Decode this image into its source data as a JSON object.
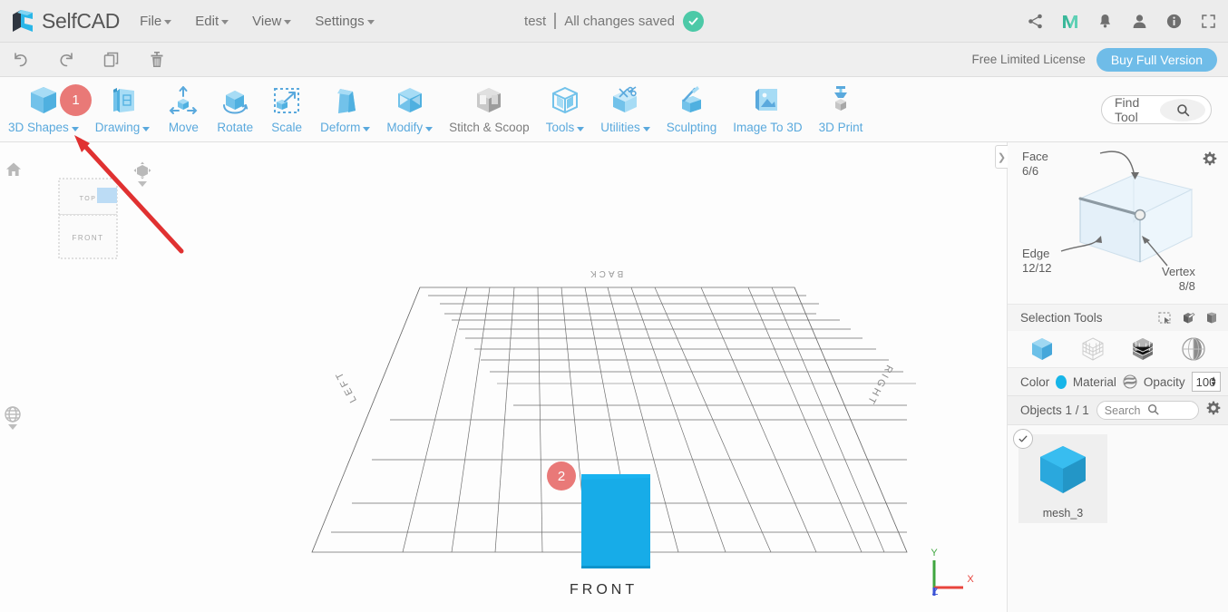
{
  "app": {
    "brand": "SelfCAD",
    "logo_icon": "selfcad-logo-icon"
  },
  "menubar": {
    "items": [
      {
        "label": "File",
        "has_caret": true
      },
      {
        "label": "Edit",
        "has_caret": true
      },
      {
        "label": "View",
        "has_caret": true
      },
      {
        "label": "Settings",
        "has_caret": true
      }
    ],
    "document_name": "test",
    "save_status": "All changes saved",
    "saved_icon": "check-circle-icon",
    "right_icons": [
      {
        "name": "share-icon"
      },
      {
        "name": "medium-logo-icon"
      },
      {
        "name": "bell-icon"
      },
      {
        "name": "user-icon"
      },
      {
        "name": "info-icon"
      },
      {
        "name": "fullscreen-icon"
      }
    ]
  },
  "editbar": {
    "buttons": [
      {
        "name": "undo-button",
        "icon": "undo-icon"
      },
      {
        "name": "redo-button",
        "icon": "redo-icon"
      },
      {
        "name": "duplicate-button",
        "icon": "copy-icon"
      },
      {
        "name": "delete-button",
        "icon": "trash-icon"
      }
    ],
    "license_text": "Free Limited License",
    "buy_label": "Buy Full Version"
  },
  "ribbon": {
    "tools": [
      {
        "label": "3D Shapes",
        "icon": "cube-icon",
        "caret": true,
        "disabled": false,
        "badge": "1"
      },
      {
        "label": "Drawing",
        "icon": "drawing-icon",
        "caret": true,
        "disabled": false
      },
      {
        "label": "Move",
        "icon": "move-icon",
        "caret": false,
        "disabled": false
      },
      {
        "label": "Rotate",
        "icon": "rotate-icon",
        "caret": false,
        "disabled": false
      },
      {
        "label": "Scale",
        "icon": "scale-icon",
        "caret": false,
        "disabled": false
      },
      {
        "label": "Deform",
        "icon": "deform-icon",
        "caret": true,
        "disabled": false
      },
      {
        "label": "Modify",
        "icon": "modify-icon",
        "caret": true,
        "disabled": false
      },
      {
        "label": "Stitch & Scoop",
        "icon": "stitch-scoop-icon",
        "caret": false,
        "disabled": true
      },
      {
        "label": "Tools",
        "icon": "tools-icon",
        "caret": true,
        "disabled": false
      },
      {
        "label": "Utilities",
        "icon": "utilities-icon",
        "caret": true,
        "disabled": false
      },
      {
        "label": "Sculpting",
        "icon": "sculpting-icon",
        "caret": false,
        "disabled": false
      },
      {
        "label": "Image To 3D",
        "icon": "image-to-3d-icon",
        "caret": false,
        "disabled": false
      },
      {
        "label": "3D Print",
        "icon": "3d-print-icon",
        "caret": false,
        "disabled": false
      }
    ],
    "find_tool_label": "Find Tool",
    "find_tool_icon": "search-icon"
  },
  "viewport": {
    "home_icon": "home-icon",
    "perspective_icon": "perspective-cube-icon",
    "globe_icon": "globe-icon",
    "viewcube": {
      "top_face": "TOP",
      "front_face": "FRONT"
    },
    "ground_labels": {
      "back": "BACK",
      "left": "LEFT",
      "right": "RIGHT",
      "front": "FRONT"
    },
    "axis": {
      "x": "X",
      "y": "Y",
      "z": "Z",
      "x_color": "#e8443c",
      "y_color": "#3fa63f",
      "z_color": "#3b53d6"
    },
    "object_color": "#17ace8",
    "callouts": [
      {
        "label": "1",
        "target": "3d-shapes-menu"
      },
      {
        "label": "2",
        "target": "viewport-object"
      }
    ]
  },
  "right_panel": {
    "collapse_icon": "chevron-right-icon",
    "selection_gear_icon": "gear-icon",
    "selection_counts": {
      "face_label": "Face",
      "face_value": "6/6",
      "edge_label": "Edge",
      "edge_value": "12/12",
      "vertex_label": "Vertex",
      "vertex_value": "8/8"
    },
    "selection_tools": {
      "title": "Selection Tools",
      "header_icons": [
        {
          "name": "rectangle-select-icon"
        },
        {
          "name": "box-select-icon"
        },
        {
          "name": "lasso-select-icon"
        }
      ],
      "modes": [
        {
          "name": "object-mode-icon",
          "active": true
        },
        {
          "name": "vertex-mode-icon",
          "active": false
        },
        {
          "name": "face-mode-icon",
          "active": false
        },
        {
          "name": "edge-mode-icon",
          "active": false
        }
      ]
    },
    "material_row": {
      "color_label": "Color",
      "color_value": "#17b5e8",
      "material_label": "Material",
      "material_icon": "material-sphere-icon",
      "opacity_label": "Opacity",
      "opacity_value": "100"
    },
    "objects": {
      "title": "Objects 1 / 1",
      "search_placeholder": "Search",
      "search_icon": "search-icon",
      "gear_icon": "gear-icon",
      "items": [
        {
          "name": "mesh_3",
          "selected": true,
          "thumb_icon": "cube-thumb-icon"
        }
      ]
    }
  }
}
